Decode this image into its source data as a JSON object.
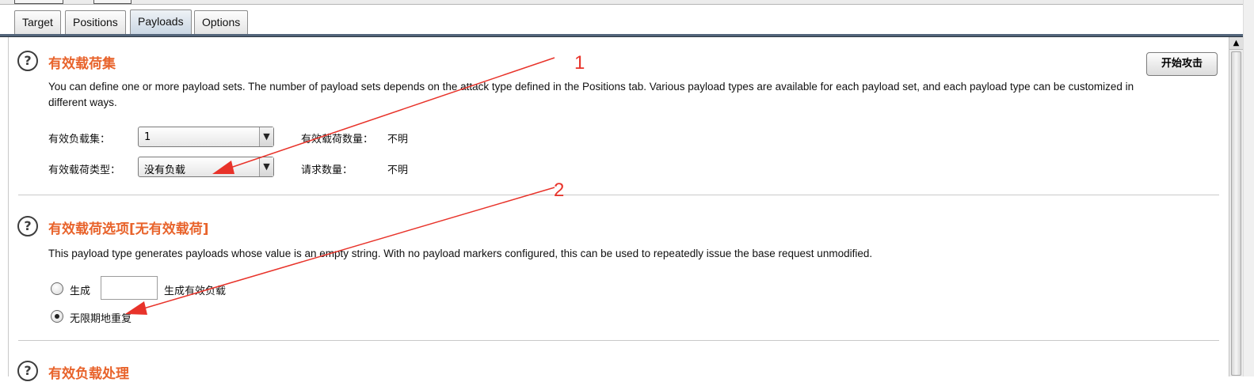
{
  "tabs": [
    "Target",
    "Positions",
    "Payloads",
    "Options"
  ],
  "active_tab": "Payloads",
  "start_attack_button": "开始攻击",
  "help_glyph": "?",
  "section1": {
    "title": "有效载荷集",
    "description": "You can define one or more payload sets. The number of payload sets depends on the attack type defined in the Positions tab. Various payload types are available for each payload set, and each payload type can be customized in different ways.",
    "payload_set_label": "有效负载集：",
    "payload_set_value": "1",
    "payload_count_label": "有效载荷数量：",
    "payload_count_value": "不明",
    "payload_type_label": "有效载荷类型：",
    "payload_type_value": "没有负载",
    "request_count_label": "请求数量：",
    "request_count_value": "不明"
  },
  "section2": {
    "title": "有效载荷选项[无有效载荷]",
    "description": "This payload type generates payloads whose value is an empty string. With no payload markers configured, this can be used to repeatedly issue the base request unmodified.",
    "generate_label": "生成",
    "generate_value": "",
    "generate_suffix": "生成有效负载",
    "repeat_label": "无限期地重复",
    "selected_option": "repeat"
  },
  "section3": {
    "title": "有效负载处理"
  },
  "annotations": {
    "label_1": "1",
    "label_2": "2",
    "color": "#e8332a"
  },
  "icons": {
    "dropdown": "chevron-down-icon",
    "scroll_up": "scroll-up-arrow-icon"
  }
}
